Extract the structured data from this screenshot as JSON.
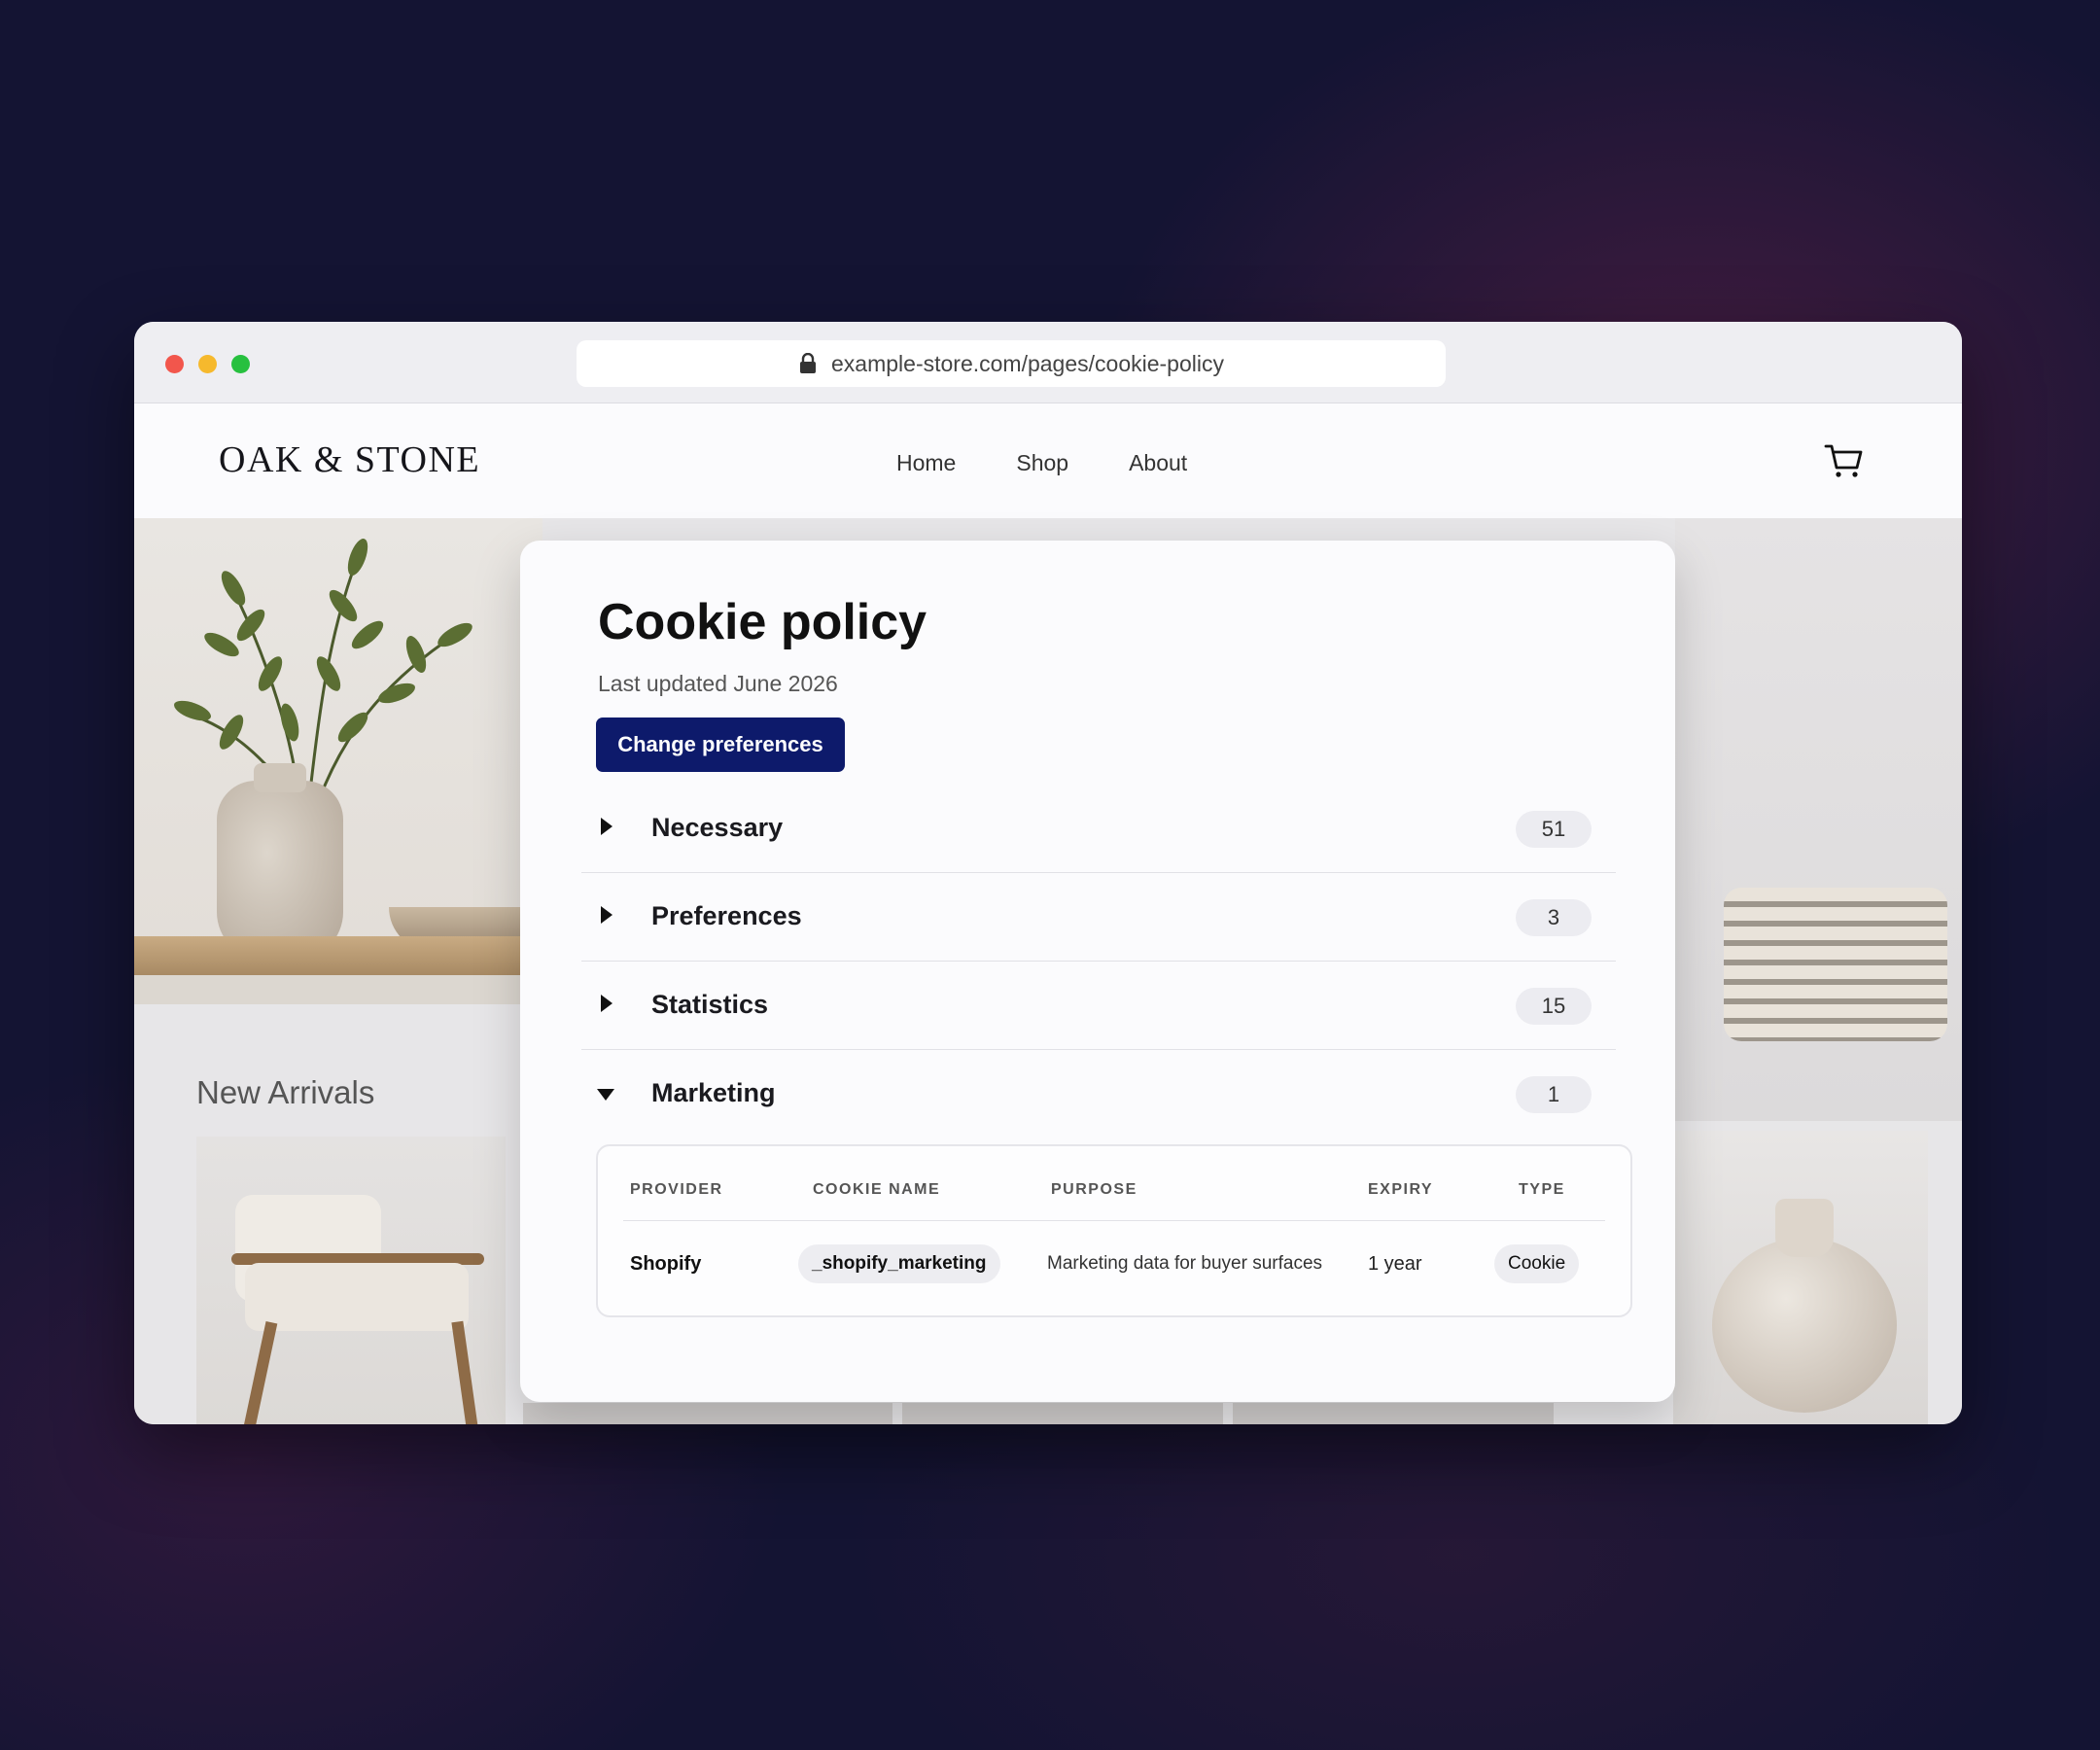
{
  "browser": {
    "url": "example-store.com/pages/cookie-policy"
  },
  "store": {
    "logo": "OAK & STONE",
    "nav": [
      "Home",
      "Shop",
      "About"
    ],
    "section_title": "New Arrivals"
  },
  "modal": {
    "title": "Cookie policy",
    "updated": "Last updated June 2026",
    "change_button": "Change preferences",
    "categories": [
      {
        "label": "Necessary",
        "count": "51",
        "expanded": false
      },
      {
        "label": "Preferences",
        "count": "3",
        "expanded": false
      },
      {
        "label": "Statistics",
        "count": "15",
        "expanded": false
      },
      {
        "label": "Marketing",
        "count": "1",
        "expanded": true
      }
    ],
    "table": {
      "headers": [
        "PROVIDER",
        "COOKIE NAME",
        "PURPOSE",
        "EXPIRY",
        "TYPE"
      ],
      "rows": [
        {
          "provider": "Shopify",
          "cookie_name": "_shopify_marketing",
          "purpose": "Marketing data for buyer surfaces",
          "expiry": "1 year",
          "type": "Cookie"
        }
      ]
    }
  },
  "icons": {
    "lock": "lock-icon",
    "cart": "cart-icon",
    "cookie": "cookie-icon"
  },
  "colors": {
    "primary_button": "#0d1a6b",
    "cookie_fab": "#1c4fe0",
    "traffic_red": "#f2564c",
    "traffic_yellow": "#f6b92d",
    "traffic_green": "#27c03f"
  }
}
